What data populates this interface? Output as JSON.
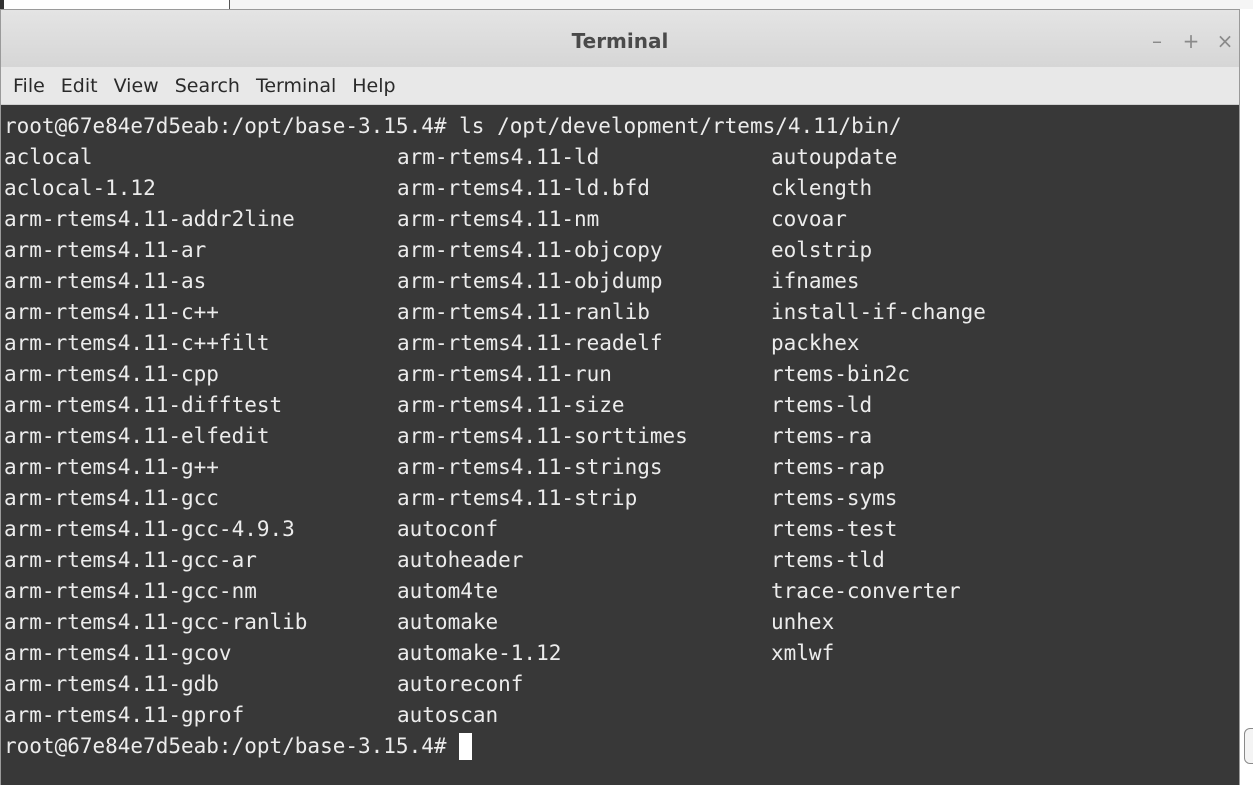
{
  "window": {
    "title": "Terminal",
    "controls": {
      "minimize": "–",
      "maximize": "+",
      "close": "×"
    }
  },
  "menu": [
    "File",
    "Edit",
    "View",
    "Search",
    "Terminal",
    "Help"
  ],
  "terminal": {
    "prompt": "root@67e84e7d5eab:/opt/base-3.15.4#",
    "command_line": "root@67e84e7d5eab:/opt/base-3.15.4# ls /opt/development/rtems/4.11/bin/",
    "rows": [
      [
        "aclocal",
        "arm-rtems4.11-ld",
        "autoupdate"
      ],
      [
        "aclocal-1.12",
        "arm-rtems4.11-ld.bfd",
        "cklength"
      ],
      [
        "arm-rtems4.11-addr2line",
        "arm-rtems4.11-nm",
        "covoar"
      ],
      [
        "arm-rtems4.11-ar",
        "arm-rtems4.11-objcopy",
        "eolstrip"
      ],
      [
        "arm-rtems4.11-as",
        "arm-rtems4.11-objdump",
        "ifnames"
      ],
      [
        "arm-rtems4.11-c++",
        "arm-rtems4.11-ranlib",
        "install-if-change"
      ],
      [
        "arm-rtems4.11-c++filt",
        "arm-rtems4.11-readelf",
        "packhex"
      ],
      [
        "arm-rtems4.11-cpp",
        "arm-rtems4.11-run",
        "rtems-bin2c"
      ],
      [
        "arm-rtems4.11-difftest",
        "arm-rtems4.11-size",
        "rtems-ld"
      ],
      [
        "arm-rtems4.11-elfedit",
        "arm-rtems4.11-sorttimes",
        "rtems-ra"
      ],
      [
        "arm-rtems4.11-g++",
        "arm-rtems4.11-strings",
        "rtems-rap"
      ],
      [
        "arm-rtems4.11-gcc",
        "arm-rtems4.11-strip",
        "rtems-syms"
      ],
      [
        "arm-rtems4.11-gcc-4.9.3",
        "autoconf",
        "rtems-test"
      ],
      [
        "arm-rtems4.11-gcc-ar",
        "autoheader",
        "rtems-tld"
      ],
      [
        "arm-rtems4.11-gcc-nm",
        "autom4te",
        "trace-converter"
      ],
      [
        "arm-rtems4.11-gcc-ranlib",
        "automake",
        "unhex"
      ],
      [
        "arm-rtems4.11-gcov",
        "automake-1.12",
        "xmlwf"
      ],
      [
        "arm-rtems4.11-gdb",
        "autoreconf",
        ""
      ],
      [
        "arm-rtems4.11-gprof",
        "autoscan",
        ""
      ]
    ]
  },
  "colors": {
    "terminal_bg": "#383838",
    "terminal_fg": "#ececec",
    "titlebar_bg": "#dcdcdc",
    "menubar_bg": "#e8e8e8"
  }
}
